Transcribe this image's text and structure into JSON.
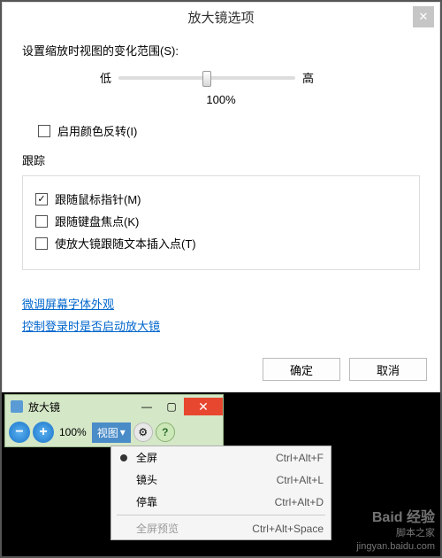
{
  "dialog": {
    "title": "放大镜选项",
    "zoom_range_label": "设置缩放时视图的变化范围(S):",
    "low": "低",
    "high": "高",
    "zoom_value": "100%",
    "invert_colors": "启用颜色反转(I)",
    "tracking_label": "跟踪",
    "track_mouse": "跟随鼠标指针(M)",
    "track_keyboard": "跟随键盘焦点(K)",
    "track_text": "使放大镜跟随文本插入点(T)",
    "link_font": "微调屏幕字体外观",
    "link_login": "控制登录时是否启动放大镜",
    "ok": "确定",
    "cancel": "取消"
  },
  "magnifier": {
    "title": "放大镜",
    "zoom": "100%",
    "view": "视图"
  },
  "menu": {
    "fullscreen": "全屏",
    "fullscreen_key": "Ctrl+Alt+F",
    "lens": "镜头",
    "lens_key": "Ctrl+Alt+L",
    "docked": "停靠",
    "docked_key": "Ctrl+Alt+D",
    "preview": "全屏预览",
    "preview_key": "Ctrl+Alt+Space"
  },
  "watermark": {
    "brand": "Baid 经验",
    "site": "脚本之家",
    "url": "jingyan.baidu.com"
  }
}
